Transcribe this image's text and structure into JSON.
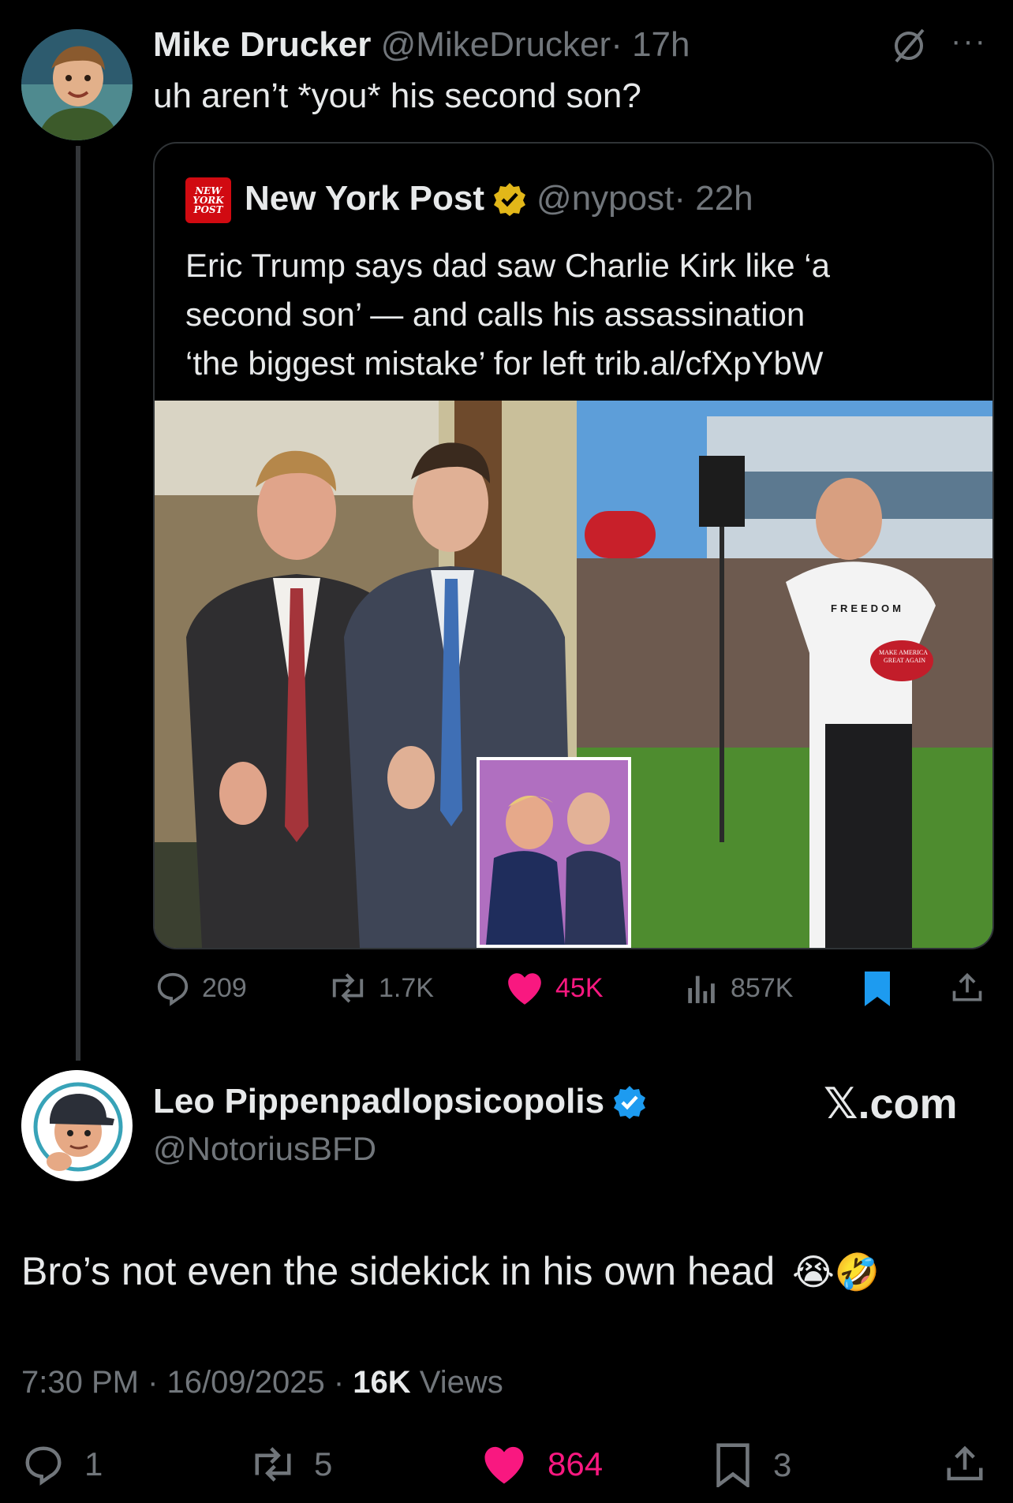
{
  "reply_tweet": {
    "author_name": "Mike Drucker",
    "handle": "@MikeDrucker",
    "time": "· 17h",
    "text": "uh aren’t *you* his second son?",
    "more": "···",
    "grok_icon": "slashed-circle-icon"
  },
  "quoted_tweet": {
    "logo_text": [
      "NEW",
      "YORK",
      "POST"
    ],
    "author_name": "New York Post",
    "handle": "@nypost",
    "time": "· 22h",
    "text_lines": [
      "Eric Trump says dad saw Charlie Kirk like ‘a",
      "second son’ — and calls his assassination",
      "‘the biggest mistake’ for left trib.al/cfXpYbW"
    ],
    "photo_shirt_text": "FREEDOM",
    "photo_hat_text": [
      "MAKE AMERICA",
      "GREAT AGAIN"
    ]
  },
  "reply_actions": {
    "replies": "209",
    "reposts": "1.7K",
    "likes": "45K",
    "views": "857K"
  },
  "main_tweet": {
    "author_name": "Leo Pippenpadlopsicopolis",
    "handle": "@NotoriusBFD",
    "watermark": "𝕏.com",
    "text": "Bro’s not even the sidekick in his own head",
    "emojis": "😭🤣",
    "time": "7:30 PM · 16/09/2025 · ",
    "views_count": "16K",
    "views_label": " Views"
  },
  "main_actions": {
    "replies": "1",
    "reposts": "5",
    "likes": "864",
    "bookmarks": "3"
  },
  "colors": {
    "background": "#000000",
    "text": "#e7e9ea",
    "muted": "#71767b",
    "like": "#f91880",
    "verified_blue": "#1d9bf0",
    "verified_gold": "#e2b719"
  }
}
